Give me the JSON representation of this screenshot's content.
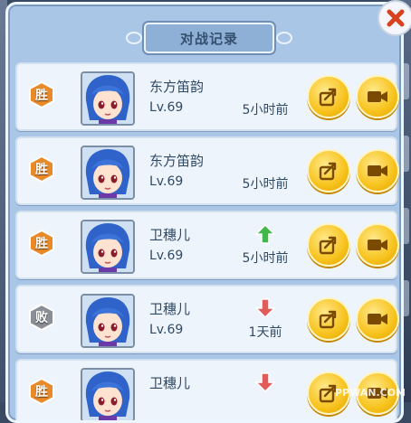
{
  "title": "对战记录",
  "close_icon": "close-icon",
  "records": [
    {
      "result": "胜",
      "outcome": "win",
      "name": "东方笛韵",
      "level": "Lv.69",
      "time": "5小时前",
      "trend": "none"
    },
    {
      "result": "胜",
      "outcome": "win",
      "name": "东方笛韵",
      "level": "Lv.69",
      "time": "5小时前",
      "trend": "none"
    },
    {
      "result": "胜",
      "outcome": "win",
      "name": "卫穗儿",
      "level": "Lv.69",
      "time": "5小时前",
      "trend": "up"
    },
    {
      "result": "败",
      "outcome": "lose",
      "name": "卫穗儿",
      "level": "Lv.69",
      "time": "1天前",
      "trend": "down"
    },
    {
      "result": "胜",
      "outcome": "win",
      "name": "卫穗儿",
      "level": "",
      "time": "",
      "trend": "down"
    }
  ],
  "colors": {
    "win_badge": "#e8892a",
    "lose_badge": "#8a8f97",
    "button_gold": "#f7c21c",
    "up_arrow": "#43b84a",
    "down_arrow": "#e25b5b"
  },
  "watermark": "PPWAN.COM"
}
